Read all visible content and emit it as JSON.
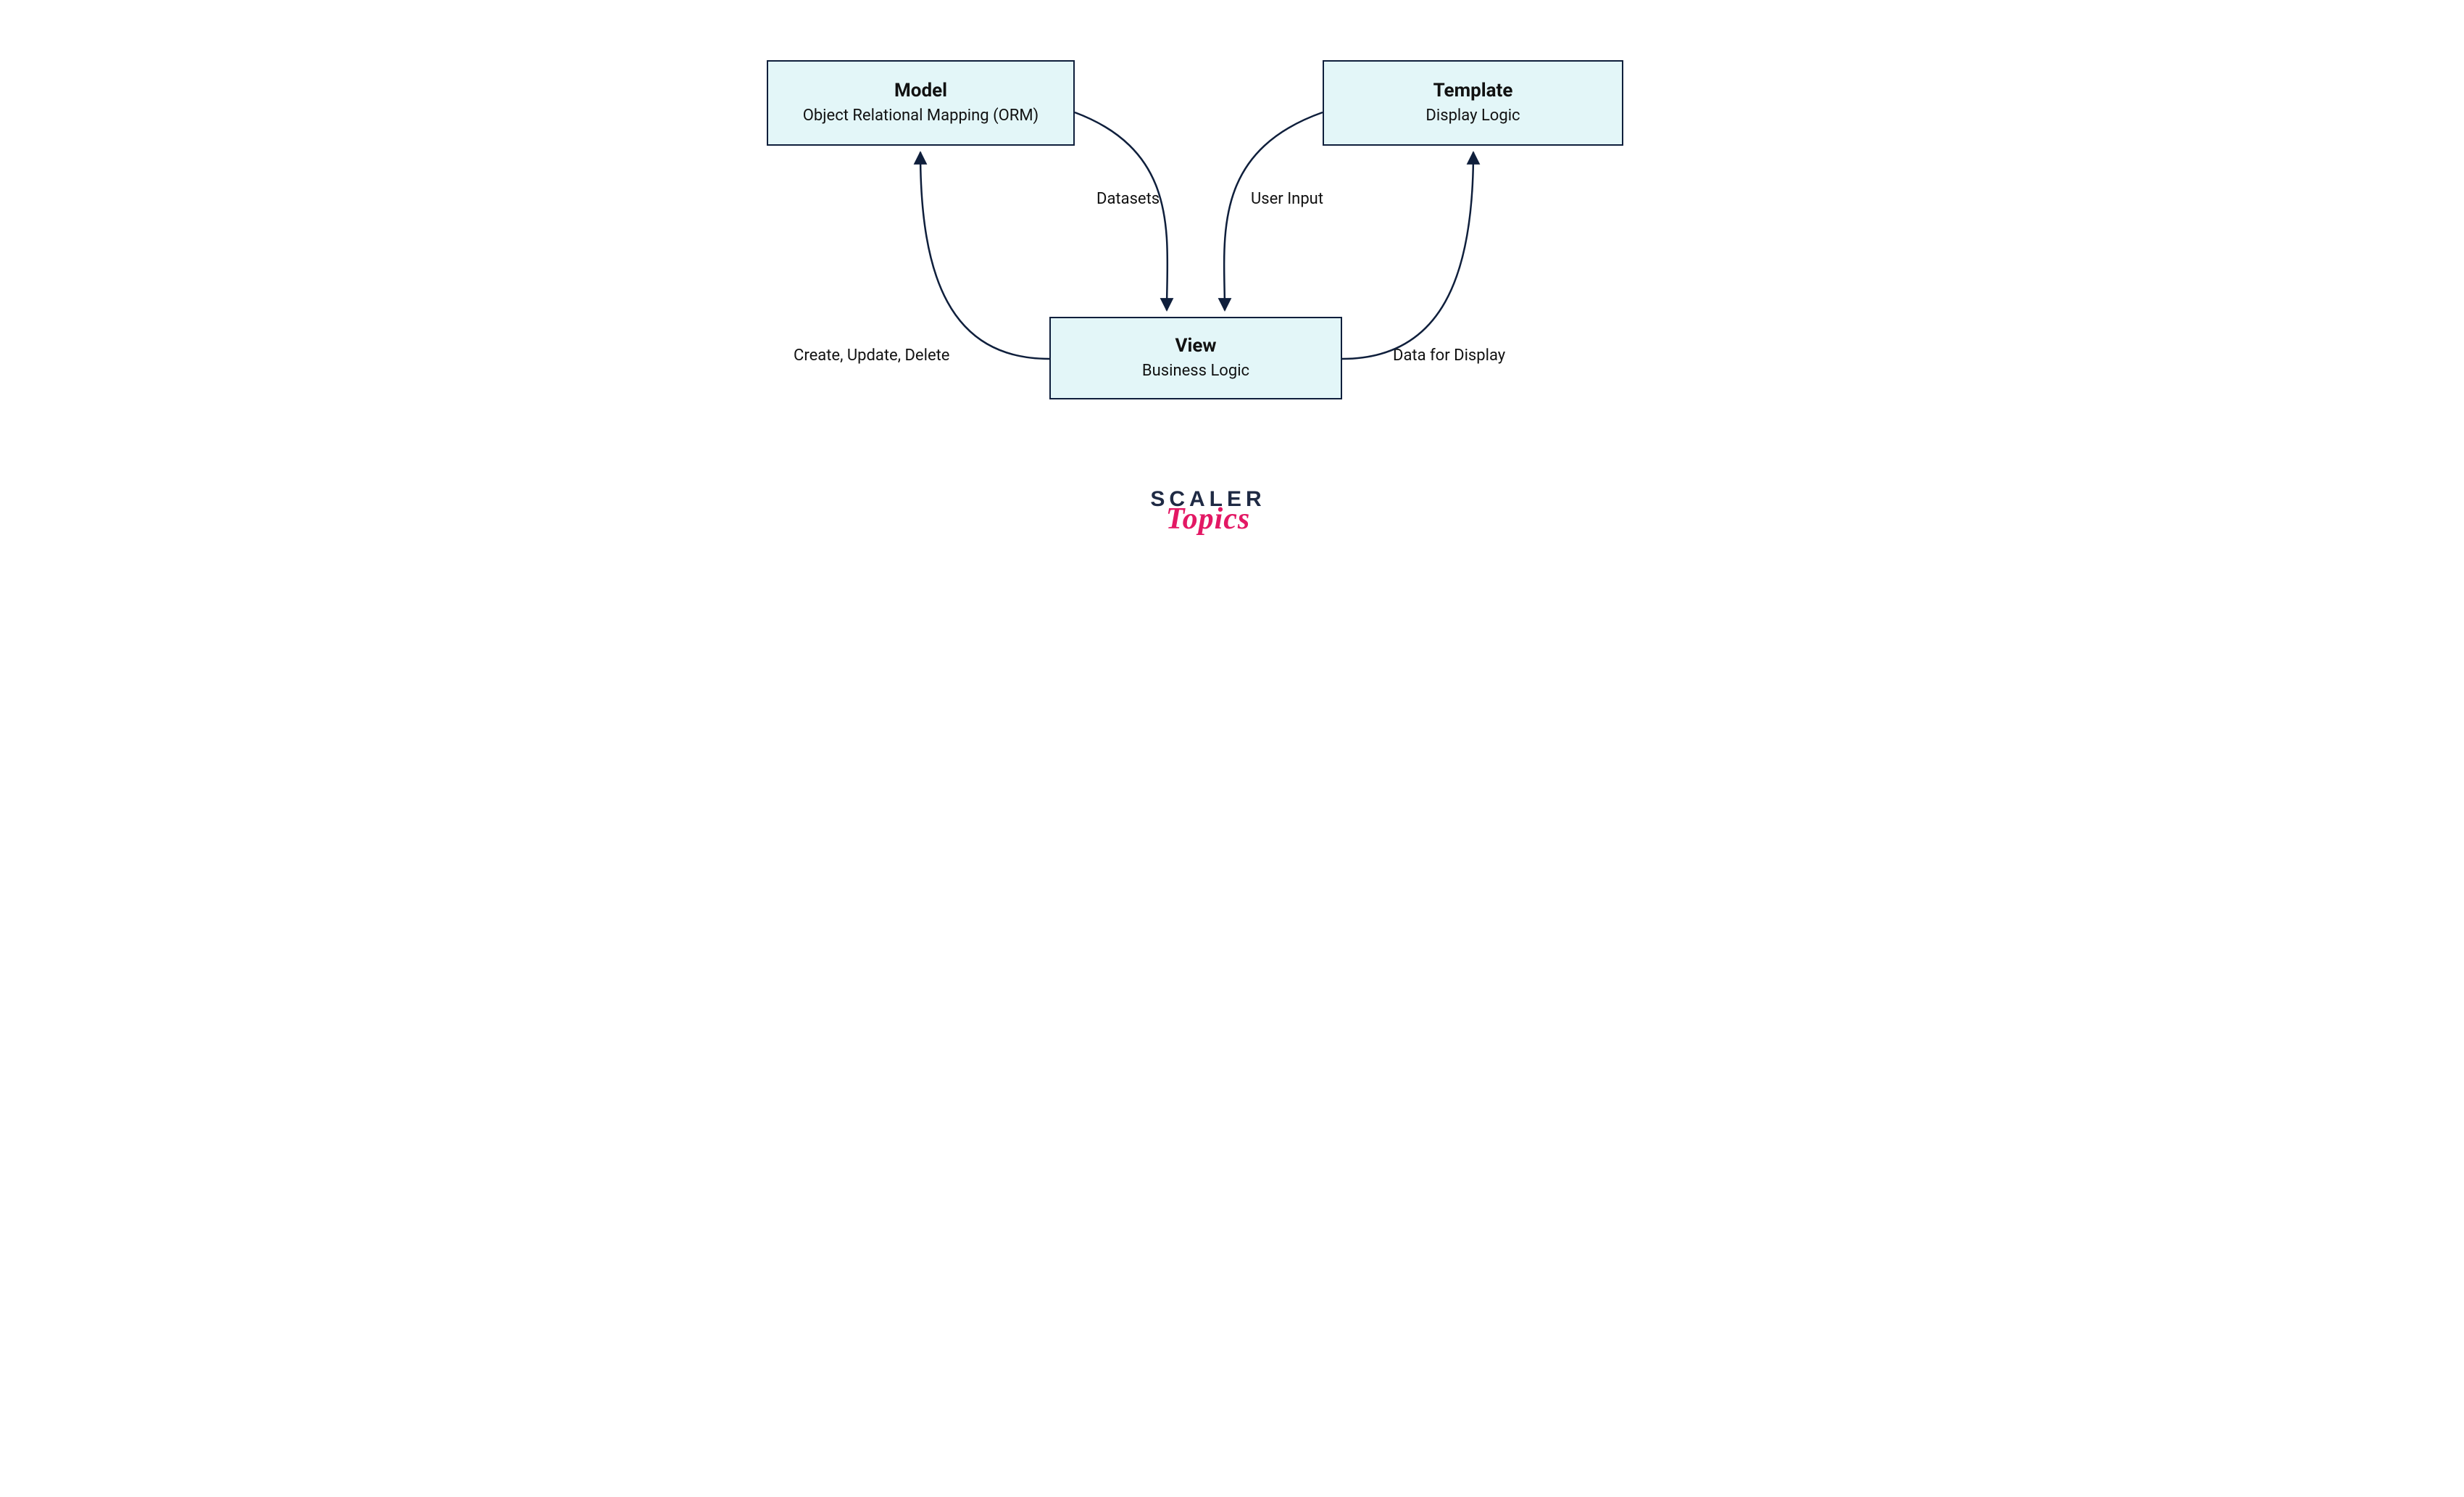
{
  "boxes": {
    "model": {
      "title": "Model",
      "subtitle": "Object Relational Mapping (ORM)"
    },
    "template": {
      "title": "Template",
      "subtitle": "Display Logic"
    },
    "view": {
      "title": "View",
      "subtitle": "Business Logic"
    }
  },
  "edges": {
    "datasets": "Datasets",
    "user_input": "User Input",
    "cud": "Create, Update, Delete",
    "data_display": "Data for Display"
  },
  "logo": {
    "line1": "SCALER",
    "line2": "Topics"
  }
}
